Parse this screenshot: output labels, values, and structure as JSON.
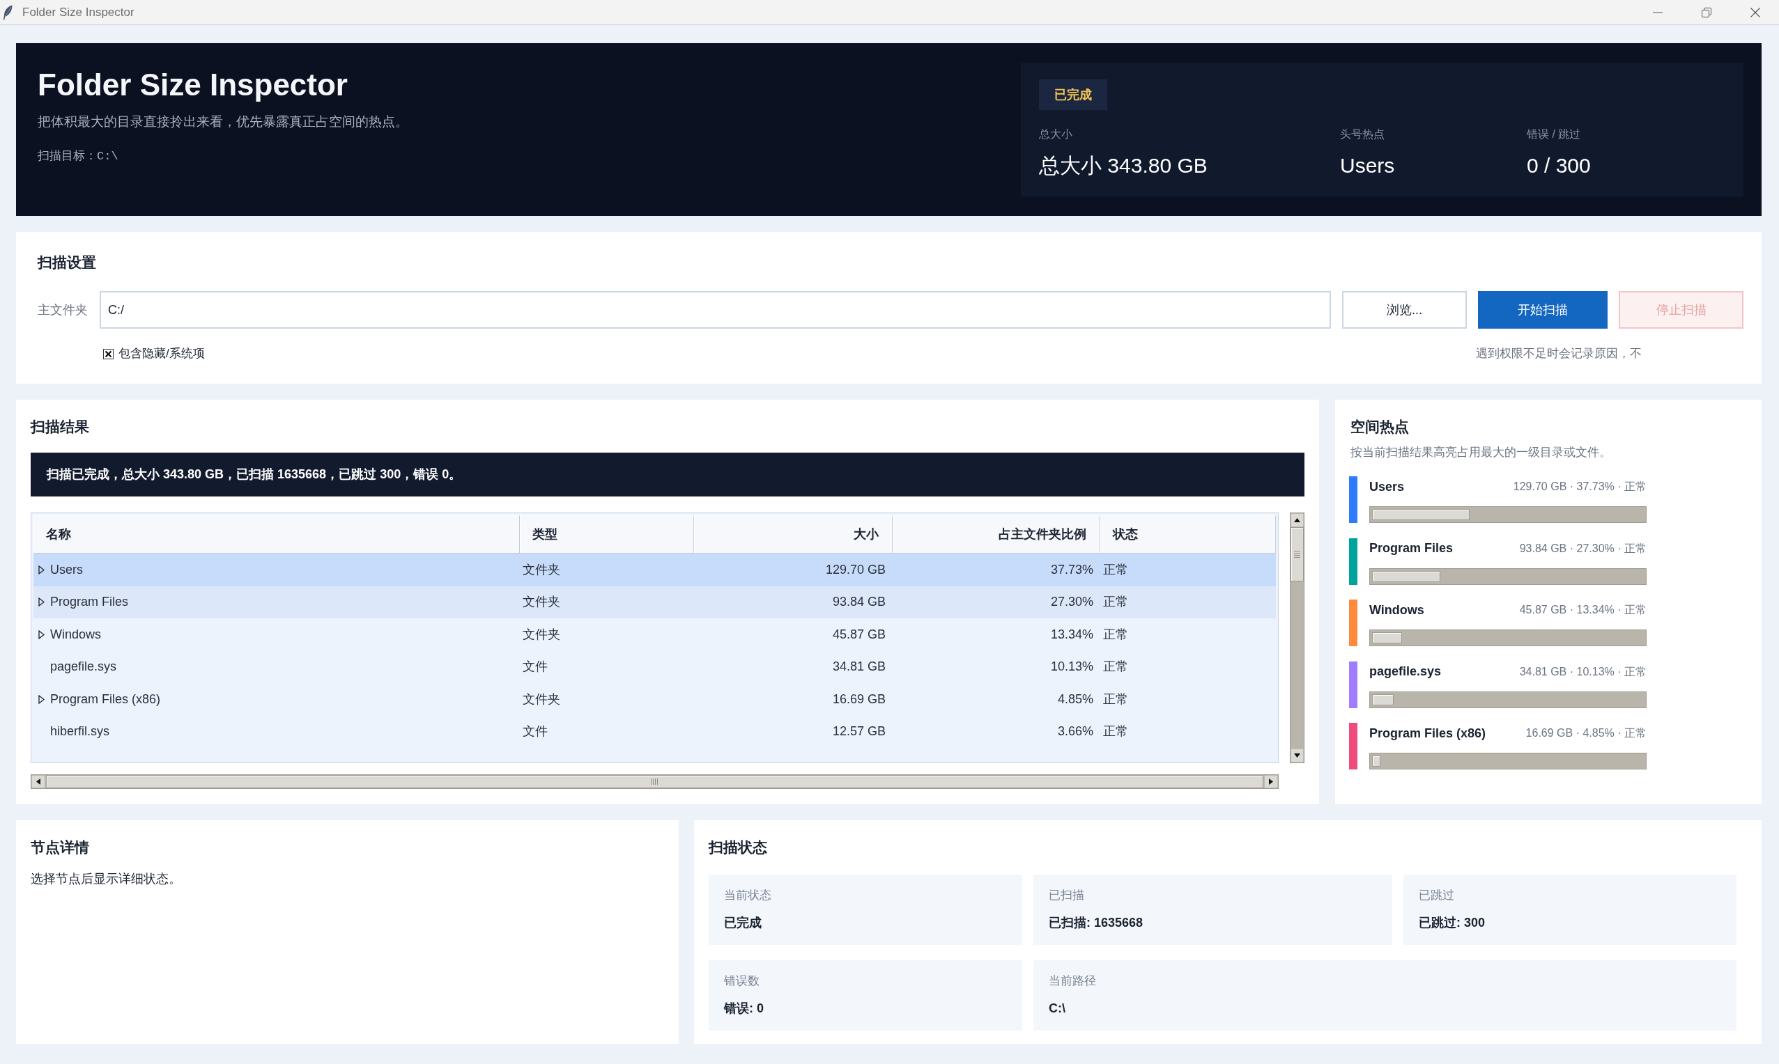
{
  "window": {
    "title": "Folder Size Inspector"
  },
  "header": {
    "title": "Folder Size Inspector",
    "subtitle": "把体积最大的目录直接拎出来看，优先暴露真正占空间的热点。",
    "target": "扫描目标：C:\\",
    "status_badge": "已完成",
    "stats": [
      {
        "label": "总大小",
        "value": "总大小 343.80 GB"
      },
      {
        "label": "头号热点",
        "value": "Users"
      },
      {
        "label": "错误 / 跳过",
        "value": "0 / 300"
      }
    ]
  },
  "settings": {
    "title": "扫描设置",
    "folder": {
      "label": "主文件夹",
      "value": "C:/"
    },
    "buttons": [
      {
        "label": "浏览...",
        "kind": "secondary",
        "disabled": false
      },
      {
        "label": "开始扫描",
        "kind": "primary",
        "disabled": false
      },
      {
        "label": "停止扫描",
        "kind": "danger",
        "disabled": true
      }
    ],
    "include_hidden": {
      "label": "包含隐藏/系统项",
      "checked": true
    },
    "note": "遇到权限不足时会记录原因，不"
  },
  "results": {
    "title": "扫描结果",
    "banner": "扫描已完成，总大小 343.80 GB，已扫描 1635668，已跳过 300，错误 0。",
    "table": {
      "columns": [
        "名称",
        "类型",
        "大小",
        "占主文件夹比例",
        "状态"
      ],
      "rows": [
        {
          "name": "Users",
          "kind": "folder",
          "expanded": false,
          "type": "文件夹",
          "size": "129.70 GB",
          "share": "37.73%",
          "status": "正常",
          "selected": true,
          "hovered": false
        },
        {
          "name": "Program Files",
          "kind": "folder",
          "expanded": false,
          "type": "文件夹",
          "size": "93.84 GB",
          "share": "27.30%",
          "status": "正常",
          "selected": false,
          "hovered": true
        },
        {
          "name": "Windows",
          "kind": "folder",
          "expanded": false,
          "type": "文件夹",
          "size": "45.87 GB",
          "share": "13.34%",
          "status": "正常",
          "selected": false,
          "hovered": false
        },
        {
          "name": "pagefile.sys",
          "kind": "file",
          "expanded": false,
          "type": "文件",
          "size": "34.81 GB",
          "share": "10.13%",
          "status": "正常",
          "selected": false,
          "hovered": false
        },
        {
          "name": "Program Files (x86)",
          "kind": "folder",
          "expanded": false,
          "type": "文件夹",
          "size": "16.69 GB",
          "share": "4.85%",
          "status": "正常",
          "selected": false,
          "hovered": false
        },
        {
          "name": "hiberfil.sys",
          "kind": "file",
          "expanded": false,
          "type": "文件",
          "size": "12.57 GB",
          "share": "3.66%",
          "status": "正常",
          "selected": false,
          "hovered": false
        }
      ]
    }
  },
  "hotspots": {
    "title": "空间热点",
    "subtitle": "按当前扫描结果高亮占用最大的一级目录或文件。",
    "items": [
      {
        "name": "Users",
        "detail": "129.70 GB · 37.73% · 正常",
        "color": "#2f7bff",
        "level": 0.36
      },
      {
        "name": "Program Files",
        "detail": "93.84 GB · 27.30% · 正常",
        "color": "#00a39b",
        "level": 0.25
      },
      {
        "name": "Windows",
        "detail": "45.87 GB · 13.34% · 正常",
        "color": "#ff8a3d",
        "level": 0.11
      },
      {
        "name": "pagefile.sys",
        "detail": "34.81 GB · 10.13% · 正常",
        "color": "#a07cff",
        "level": 0.08
      },
      {
        "name": "Program Files (x86)",
        "detail": "16.69 GB · 4.85% · 正常",
        "color": "#ef4b7d",
        "level": 0.03
      }
    ]
  },
  "node_details": {
    "title": "节点详情",
    "text": "选择节点后显示详细状态。"
  },
  "scan_status": {
    "title": "扫描状态",
    "cells": [
      {
        "label": "当前状态",
        "value": "已完成"
      },
      {
        "label": "已扫描",
        "value": "已扫描: 1635668"
      },
      {
        "label": "已跳过",
        "value": "已跳过: 300"
      },
      {
        "label": "错误数",
        "value": "错误: 0"
      },
      {
        "label": "当前路径",
        "value": "C:\\"
      }
    ]
  }
}
